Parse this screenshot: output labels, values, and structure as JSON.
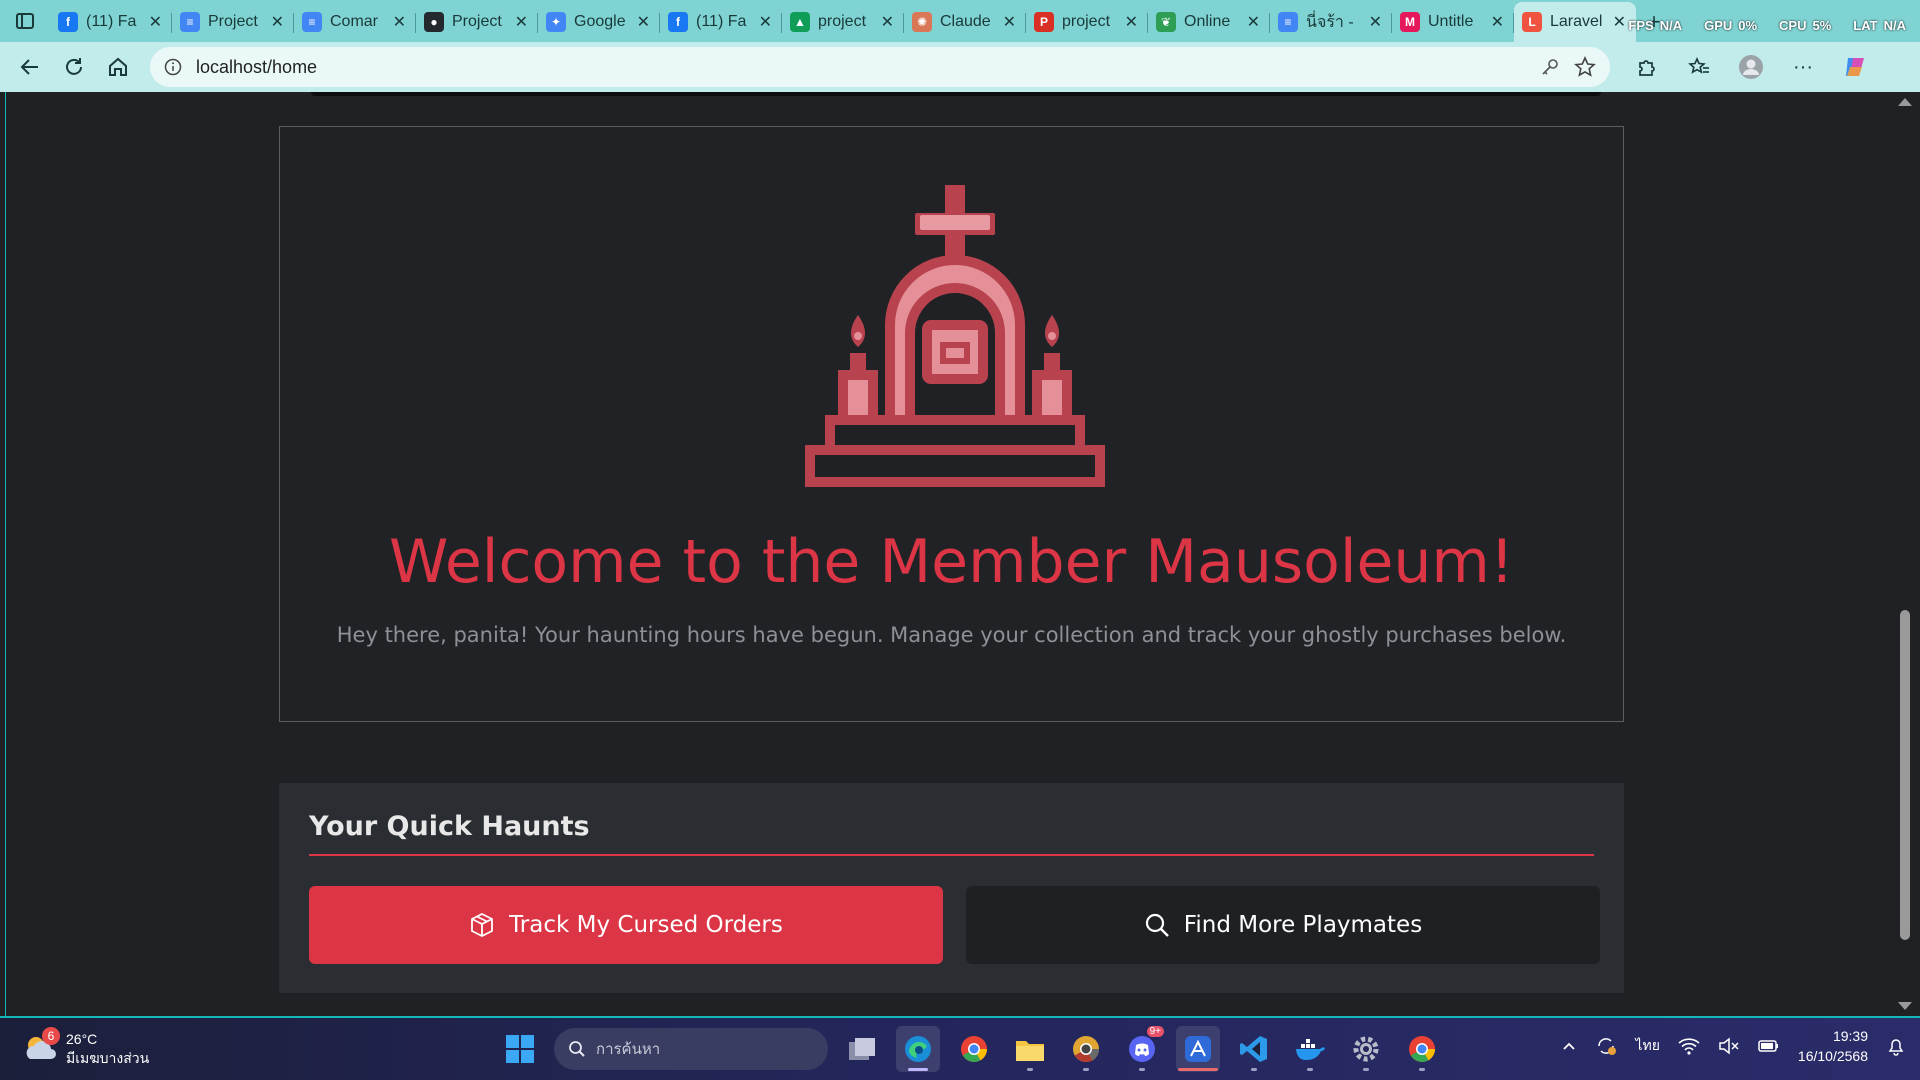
{
  "browser": {
    "tabs": [
      {
        "title": "(11) Fa",
        "icon": "facebook-icon",
        "color": "#1877f2"
      },
      {
        "title": "Project",
        "icon": "docs-icon",
        "color": "#4285f4"
      },
      {
        "title": "Comar",
        "icon": "docs-icon",
        "color": "#4285f4"
      },
      {
        "title": "Project",
        "icon": "github-icon",
        "color": "#24292e"
      },
      {
        "title": "Google",
        "icon": "gemini-icon",
        "color": "#4285f4"
      },
      {
        "title": "(11) Fa",
        "icon": "facebook-icon",
        "color": "#1877f2"
      },
      {
        "title": "project",
        "icon": "drive-icon",
        "color": "#0f9d58"
      },
      {
        "title": "Claude",
        "icon": "claude-icon",
        "color": "#d97757"
      },
      {
        "title": "project",
        "icon": "pdf-icon",
        "color": "#d93025"
      },
      {
        "title": "Online",
        "icon": "leaf-icon",
        "color": "#2e9e55"
      },
      {
        "title": "นี่จร้า -",
        "icon": "docs-icon",
        "color": "#4285f4"
      },
      {
        "title": "Untitle",
        "icon": "miro-icon",
        "color": "#e5185c"
      },
      {
        "title": "Laravel",
        "icon": "laravel-icon",
        "color": "#f05340"
      }
    ],
    "active_tab_index": 12,
    "perf": {
      "fps_label": "FPS",
      "fps_value": "N/A",
      "gpu_label": "GPU",
      "gpu_value": "0%",
      "cpu_label": "CPU",
      "cpu_value": "5%",
      "lat_label": "LAT",
      "lat_value": "N/A"
    },
    "url": "localhost/home"
  },
  "page": {
    "hero": {
      "icon": "mausoleum-icon",
      "title": "Welcome to the Member Mausoleum!",
      "subtitle": "Hey there, panita! Your haunting hours have begun. Manage your collection and track your ghostly purchases below."
    },
    "quick": {
      "title": "Your Quick Haunts",
      "orders_label": "Track My Cursed Orders",
      "find_label": "Find More Playmates"
    },
    "colors": {
      "accent": "#dc3545",
      "background": "#1f2124",
      "panel": "#2a2d31"
    }
  },
  "taskbar": {
    "weather": {
      "temp": "26°C",
      "desc": "มีเมฆบางส่วน",
      "badge": "6"
    },
    "search_placeholder": "การค้นหา",
    "discord_badge": "9+",
    "language": "ไทย",
    "time": "19:39",
    "date": "16/10/2568"
  }
}
